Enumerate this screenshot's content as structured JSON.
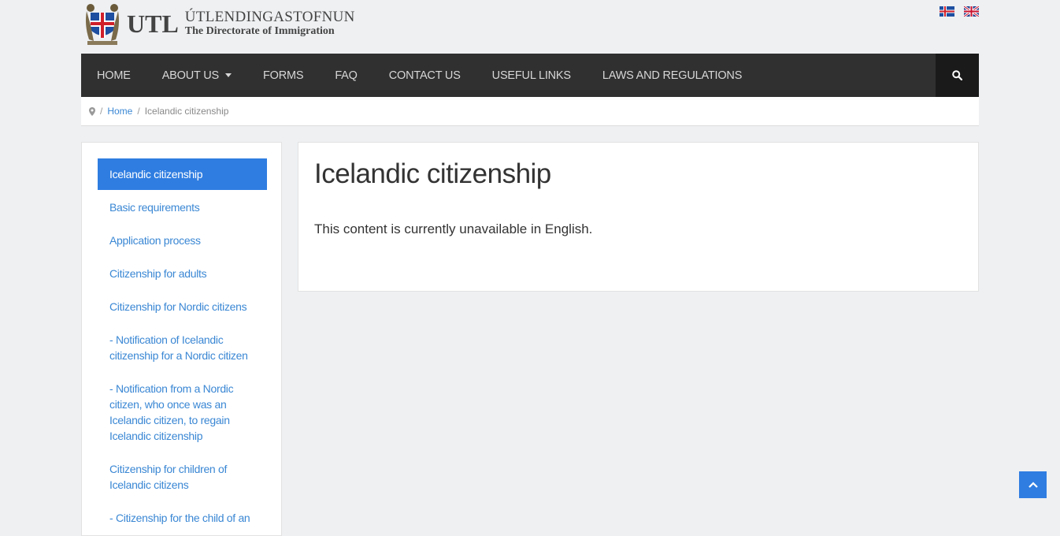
{
  "header": {
    "logo_abbr": "UTL",
    "logo_name_is": "ÚTLENDINGASTOFNUN",
    "logo_name_en": "The Directorate of Immigration",
    "languages": [
      {
        "code": "is",
        "icon": "icelandic-flag-icon"
      },
      {
        "code": "en",
        "icon": "uk-flag-icon"
      }
    ]
  },
  "nav": {
    "items": [
      "HOME",
      "ABOUT US",
      "FORMS",
      "FAQ",
      "CONTACT US",
      "USEFUL LINKS",
      "LAWS AND REGULATIONS"
    ],
    "search_icon": "search-icon"
  },
  "breadcrumb": {
    "home": "Home",
    "current": "Icelandic citizenship",
    "separator": "/"
  },
  "sidebar": {
    "items": [
      "Icelandic citizenship",
      "Basic requirements",
      "Application process",
      "Citizenship for adults",
      "Citizenship for Nordic citizens",
      "- Notification of Icelandic citizenship for a Nordic citizen",
      "- Notification from a Nordic citizen, who once was an Icelandic citizen, to regain Icelandic citizenship",
      "Citizenship for children of Icelandic citizens",
      "- Citizenship for the child of an"
    ]
  },
  "main": {
    "title": "Icelandic citizenship",
    "text": "This content is currently unavailable in English."
  },
  "colors": {
    "accent": "#2f7de1",
    "navbar": "#303030",
    "link": "#3a87d4"
  }
}
